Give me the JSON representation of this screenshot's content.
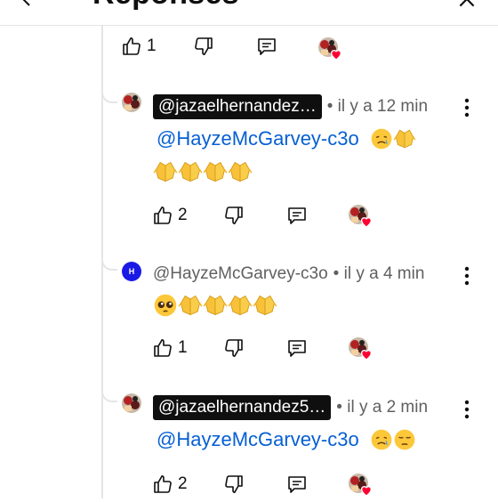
{
  "header": {
    "title": "Réponses"
  },
  "top_actions": {
    "like_count": "1"
  },
  "replies": [
    {
      "author": "@jazaelhernandez…",
      "author_chip": true,
      "time": "il y a 12 min",
      "mention": "@HayzeMcGarvey-c3o",
      "emojis": [
        "crying-face",
        "folded-hands",
        "folded-hands",
        "folded-hands",
        "folded-hands",
        "folded-hands"
      ],
      "like_count": "2"
    },
    {
      "author": "@HayzeMcGarvey-c3o",
      "author_chip": false,
      "avatar_letter": "H",
      "time": "il y a 4 min",
      "mention": "",
      "emojis": [
        "pleading-face",
        "folded-hands",
        "folded-hands",
        "folded-hands",
        "folded-hands"
      ],
      "like_count": "1"
    },
    {
      "author": "@jazaelhernandez5…",
      "author_chip": true,
      "time": "il y a 2 min",
      "mention": "@HayzeMcGarvey-c3o",
      "emojis": [
        "crying-face",
        "pensive-face"
      ],
      "like_count": "2"
    }
  ],
  "colors": {
    "mention": "#065fd4",
    "heart": "#ff0033",
    "chip_bg": "#0f0f0f",
    "hand_avatar": "#1a1ae6"
  }
}
